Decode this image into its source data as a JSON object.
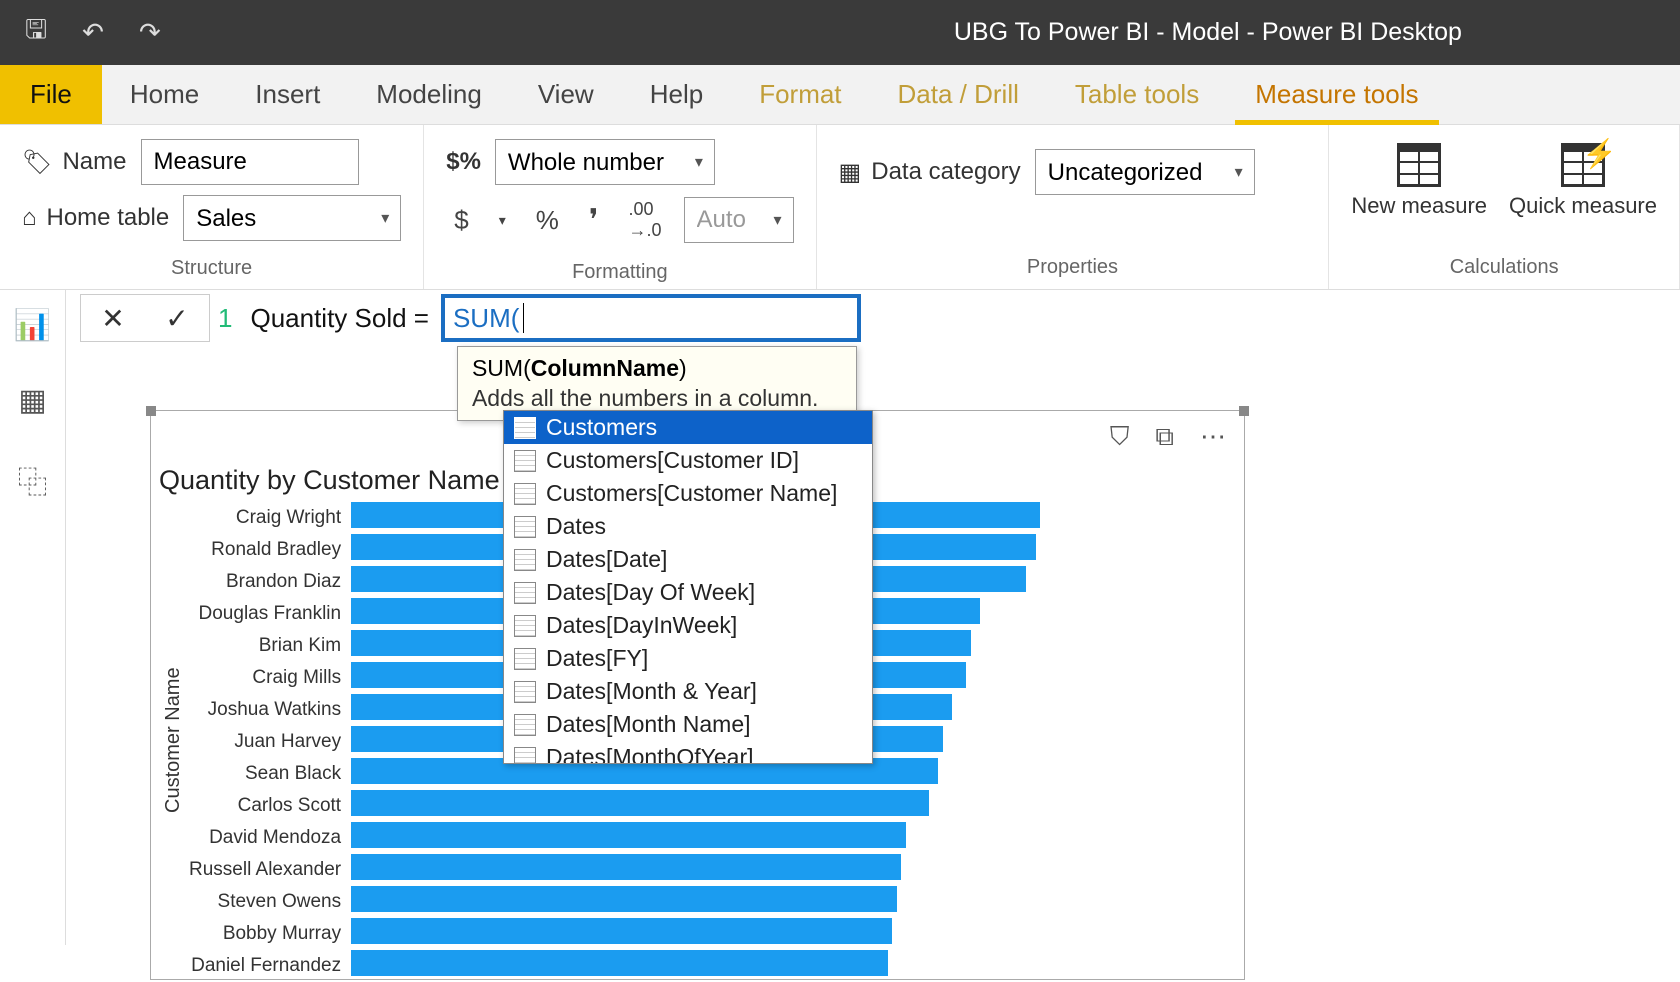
{
  "window": {
    "title": "UBG To Power BI - Model - Power BI Desktop"
  },
  "tabs": {
    "file": "File",
    "list": [
      "Home",
      "Insert",
      "Modeling",
      "View",
      "Help",
      "Format",
      "Data / Drill",
      "Table tools",
      "Measure tools"
    ],
    "active": 8,
    "dim_from": 5
  },
  "ribbon": {
    "structure": {
      "name_label": "Name",
      "name_value": "Measure",
      "home_label": "Home table",
      "home_value": "Sales",
      "group": "Structure"
    },
    "formatting": {
      "type_value": "Whole number",
      "currency": "$",
      "percent": "%",
      "comma": ",",
      "decimals": ".00→.0",
      "auto": "Auto",
      "group": "Formatting"
    },
    "properties": {
      "cat_label": "Data category",
      "cat_value": "Uncategorized",
      "group": "Properties"
    },
    "calculations": {
      "new": "New measure",
      "quick": "Quick measure",
      "group": "Calculations"
    }
  },
  "formula": {
    "cancel": "✕",
    "commit": "✓",
    "line_no": "1",
    "prefix": "Quantity Sold =",
    "func": "SUM(",
    "tooltip_sig_pre": "SUM(",
    "tooltip_sig_arg": "ColumnName",
    "tooltip_sig_post": ")",
    "tooltip_desc": "Adds all the numbers in a column."
  },
  "intellisense": [
    "Customers",
    "Customers[Customer ID]",
    "Customers[Customer Name]",
    "Dates",
    "Dates[Date]",
    "Dates[Day Of Week]",
    "Dates[DayInWeek]",
    "Dates[FY]",
    "Dates[Month & Year]",
    "Dates[Month Name]",
    "Dates[MonthOfYear]"
  ],
  "chart_data": {
    "type": "bar",
    "title": "Quantity by Customer Name",
    "ylabel": "Customer Name",
    "categories": [
      "Craig Wright",
      "Ronald Bradley",
      "Brandon Diaz",
      "Douglas Franklin",
      "Brian Kim",
      "Craig Mills",
      "Joshua Watkins",
      "Juan Harvey",
      "Sean Black",
      "Carlos Scott",
      "David Mendoza",
      "Russell Alexander",
      "Steven Owens",
      "Bobby Murray",
      "Daniel Fernandez"
    ],
    "values": [
      745,
      740,
      730,
      680,
      670,
      665,
      650,
      640,
      635,
      625,
      600,
      595,
      590,
      585,
      580
    ],
    "xlim": [
      0,
      800
    ]
  },
  "chart_hdr": {
    "filter": "⛉",
    "focus": "⧉",
    "more": "⋯"
  }
}
